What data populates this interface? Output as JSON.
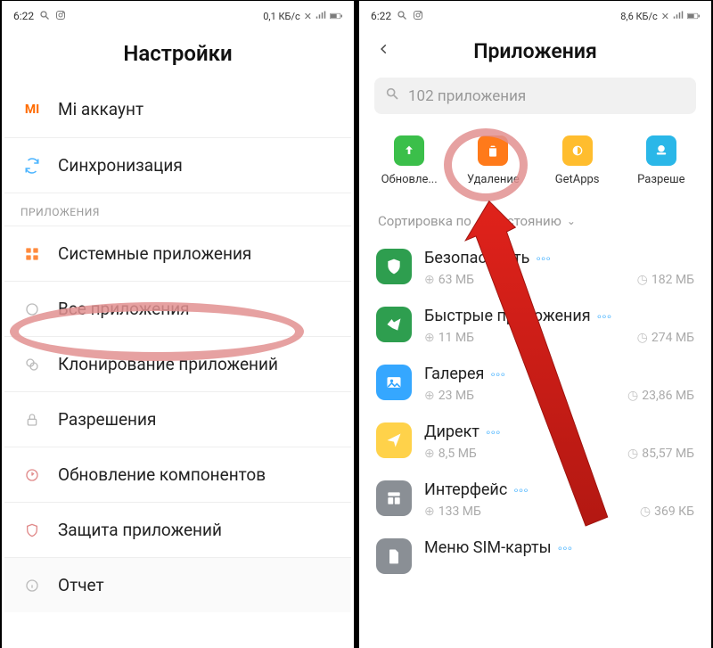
{
  "left": {
    "statusbar": {
      "time": "6:22",
      "net": "0,1 КБ/с"
    },
    "title": "Настройки",
    "rows": {
      "mi_account": "Mi аккаунт",
      "sync": "Синхронизация"
    },
    "section": "ПРИЛОЖЕНИЯ",
    "apps_rows": {
      "system_apps": "Системные приложения",
      "all_apps": "Все приложения",
      "clone": "Клонирование приложений",
      "perms": "Разрешения",
      "update": "Обновление компонентов",
      "protect": "Защита приложений",
      "report": "Отчет"
    }
  },
  "right": {
    "statusbar": {
      "time": "6:22",
      "net": "8,6 КБ/с"
    },
    "title": "Приложения",
    "search": "102 приложения",
    "tabs": {
      "update": "Обновле...",
      "delete": "Удаление",
      "getapps": "GetApps",
      "perms": "Разреше"
    },
    "sort": {
      "prefix": "Сортировка по",
      "mid": "стоянию"
    },
    "apps": [
      {
        "name": "Безопасность",
        "size": "63 МБ",
        "time": "182 МБ",
        "color": "#2e9e4f",
        "icon": "shield"
      },
      {
        "name": "Быстрые приложения",
        "size": "11 МБ",
        "time": "274 МБ",
        "color": "#2e9e4f",
        "icon": "bird"
      },
      {
        "name": "Галерея",
        "size": "23 МБ",
        "time": "23,86 МБ",
        "color": "#35a7ff",
        "icon": "image"
      },
      {
        "name": "Директ",
        "size": "8,5 МБ",
        "time": "85,57 МБ",
        "color": "#ffd24a",
        "icon": "direct"
      },
      {
        "name": "Интерфейс",
        "size": "133 МБ",
        "time": "369 КБ",
        "color": "#8a8f95",
        "icon": "layout"
      },
      {
        "name": "Меню SIM-карты",
        "size": "",
        "time": "",
        "color": "#8a8f95",
        "icon": "sim"
      }
    ]
  }
}
